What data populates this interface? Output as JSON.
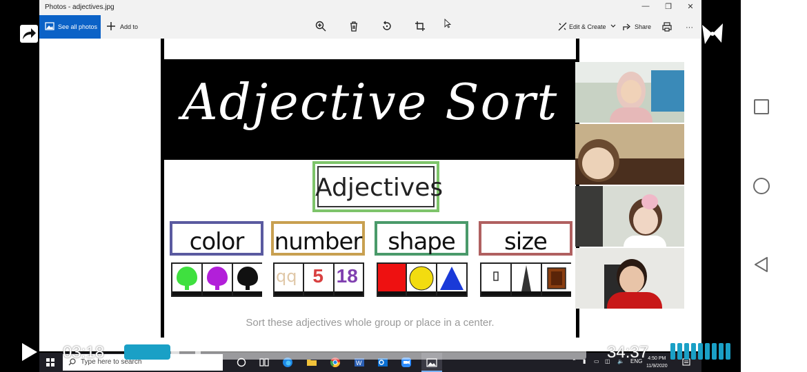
{
  "window": {
    "title": "Photos - adjectives.jpg",
    "minimize": "—",
    "maximize": "❐",
    "close": "✕"
  },
  "toolbar": {
    "see_all": "See all photos",
    "add_to": "Add to",
    "edit_create": "Edit & Create",
    "share": "Share",
    "more": "···"
  },
  "zoom": {
    "level_fraction": 0.49
  },
  "sheet": {
    "title": "Adjective Sort",
    "header": "Adjectives",
    "categories": [
      {
        "label": "color",
        "border": "#5a5aa0"
      },
      {
        "label": "number",
        "border": "#c8a050"
      },
      {
        "label": "shape",
        "border": "#4a9a6a"
      },
      {
        "label": "size",
        "border": "#b06060"
      }
    ],
    "number_cards": [
      "qq",
      "5",
      "18"
    ],
    "note": "Sort these adjectives whole group or place in a center."
  },
  "player": {
    "current_time": "03:18",
    "total_time": "34:37",
    "progress_fraction": 0.1,
    "accent": "#1aa0c6"
  },
  "taskbar": {
    "search_placeholder": "Type here to search",
    "lang": "ENG",
    "time": "4:50 PM",
    "date": "11/9/2020"
  }
}
